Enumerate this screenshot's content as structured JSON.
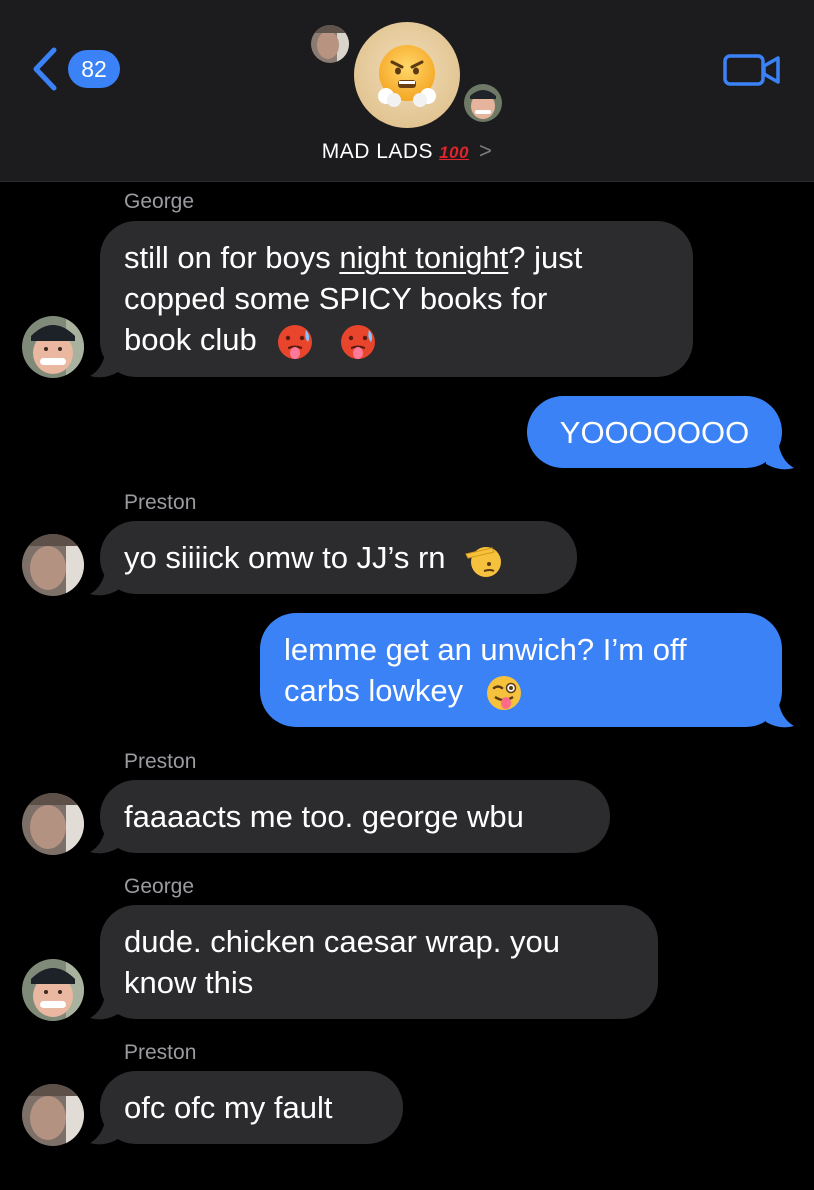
{
  "header": {
    "back_count": "82",
    "group_name": "MAD LADS",
    "group_emoji": "100",
    "group_chevron": ">"
  },
  "colors": {
    "header_bg": "#1c1c1e",
    "incoming_bubble": "#2c2c2e",
    "outgoing_bubble": "#3a82f6",
    "accent": "#3a82f6",
    "sender_name": "#9a9aa0"
  },
  "messages": [
    {
      "sender": "George",
      "direction": "incoming",
      "lines": [
        "still on for boys ",
        "night tonight",
        "? just",
        "copped some SPICY books for",
        "book club"
      ]
    },
    {
      "sender": "",
      "direction": "outgoing",
      "text": "YOOOOOOO"
    },
    {
      "sender": "Preston",
      "direction": "incoming",
      "text": "yo siiiick omw to JJ’s rn"
    },
    {
      "sender": "",
      "direction": "outgoing",
      "lines": [
        "lemme get an unwich? I’m off",
        "carbs lowkey"
      ]
    },
    {
      "sender": "Preston",
      "direction": "incoming",
      "text": "faaaacts me too. george wbu"
    },
    {
      "sender": "George",
      "direction": "incoming",
      "lines": [
        "dude. chicken caesar wrap. you",
        "know this"
      ]
    },
    {
      "sender": "Preston",
      "direction": "incoming",
      "text": "ofc ofc my fault"
    }
  ],
  "icons": {
    "back": "chevron-left-icon",
    "video": "video-camera-icon",
    "group_avatar": "face-with-steam-emoji",
    "hot_face": "hot-face-emoji",
    "salute": "saluting-face-emoji",
    "wink": "winking-tongue-emoji"
  }
}
